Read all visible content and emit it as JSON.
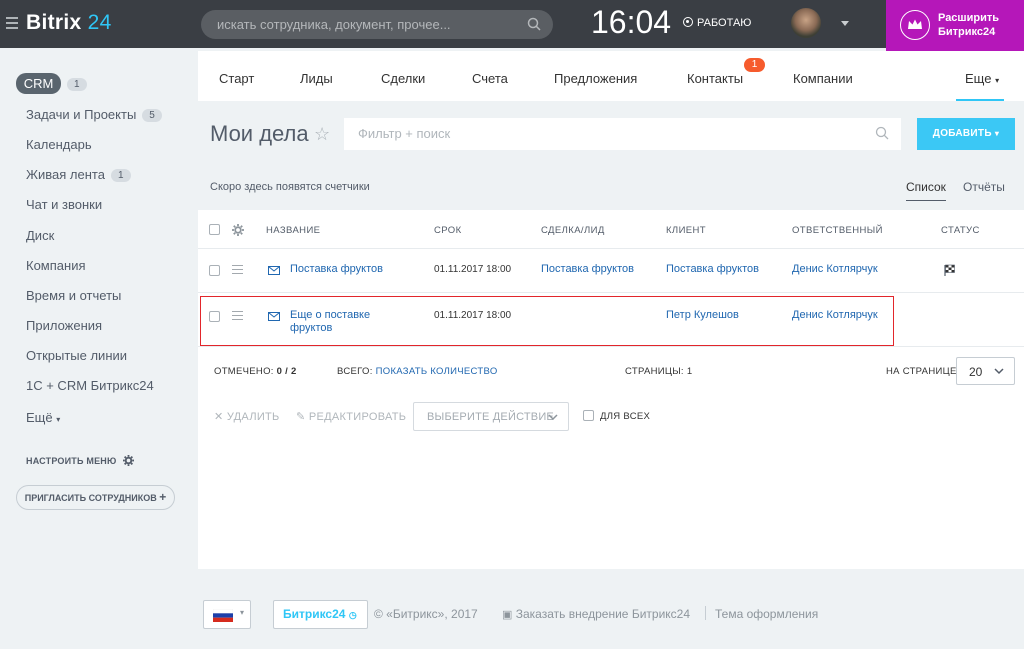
{
  "header": {
    "logo": "Bitrix",
    "logo_num": "24",
    "search_placeholder": "искать сотрудника, документ, прочее...",
    "time": "16:04",
    "work_status": "РАБОТАЮ",
    "upgrade_line1": "Расширить",
    "upgrade_line2": "Битрикс24"
  },
  "sidebar": {
    "crm": {
      "label": "CRM",
      "count": "1"
    },
    "items": [
      {
        "label": "Задачи и Проекты",
        "count": "5"
      },
      {
        "label": "Календарь"
      },
      {
        "label": "Живая лента",
        "count": "1"
      },
      {
        "label": "Чат и звонки"
      },
      {
        "label": "Диск"
      },
      {
        "label": "Компания"
      },
      {
        "label": "Время и отчеты"
      },
      {
        "label": "Приложения"
      },
      {
        "label": "Открытые линии"
      },
      {
        "label": "1С + CRM Битрикс24"
      },
      {
        "label": "Ещё"
      }
    ],
    "configure": "НАСТРОИТЬ МЕНЮ",
    "invite": "ПРИГЛАСИТЬ СОТРУДНИКОВ"
  },
  "tabs": {
    "items": [
      "Старт",
      "Лиды",
      "Сделки",
      "Счета",
      "Предложения",
      "Контакты",
      "Компании"
    ],
    "contacts_badge": "1",
    "more": "Еще"
  },
  "page": {
    "title": "Мои дела",
    "filter_placeholder": "Фильтр + поиск",
    "add_button": "ДОБАВИТЬ",
    "counters_note": "Скоро здесь появятся счетчики",
    "view_list": "Список",
    "view_reports": "Отчёты"
  },
  "table": {
    "headers": [
      "НАЗВАНИЕ",
      "СРОК",
      "СДЕЛКА/ЛИД",
      "КЛИЕНТ",
      "ОТВЕТСТВЕННЫЙ",
      "СТАТУС"
    ],
    "rows": [
      {
        "name": "Поставка фруктов",
        "date": "01.11.2017 18:00",
        "deal": "Поставка фруктов",
        "client": "Поставка фруктов",
        "responsible": "Денис Котлярчук",
        "status_icon": "checkered-flag-icon"
      },
      {
        "name_line1": "Еще о поставке",
        "name_line2": "фруктов",
        "date": "01.11.2017 18:00",
        "deal": "",
        "client": "Петр Кулешов",
        "responsible": "Денис Котлярчук"
      }
    ],
    "marked_label": "ОТМЕЧЕНО:",
    "marked_value": "0 / 2",
    "total_label": "ВСЕГО:",
    "total_link": "ПОКАЗАТЬ КОЛИЧЕСТВО",
    "pages_label": "СТРАНИЦЫ:",
    "pages_value": "1",
    "per_page_label": "НА СТРАНИЦЕ:",
    "per_page_value": "20"
  },
  "actions": {
    "delete": "УДАЛИТЬ",
    "edit": "РЕДАКТИРОВАТЬ",
    "select_action": "ВЫБЕРИТЕ ДЕЙСТВИЕ",
    "for_all": "ДЛЯ ВСЕХ"
  },
  "footer": {
    "b24_label": "Битрикс24",
    "copyright": "© «Битрикс», 2017",
    "order": "Заказать внедрение Битрикс24",
    "theme": "Тема оформления"
  },
  "colors": {
    "accent": "#2fc6f6",
    "upgrade": "#b517b9",
    "link": "#2067b0",
    "highlight": "#e2262b"
  }
}
